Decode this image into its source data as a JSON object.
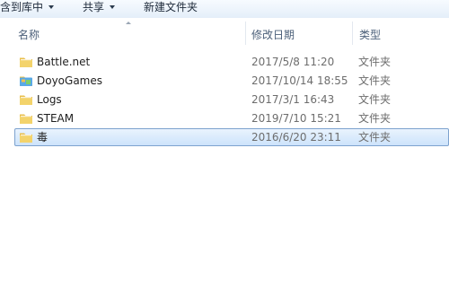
{
  "toolbar": {
    "include_in_library": "含到库中",
    "share": "共享",
    "new_folder": "新建文件夹"
  },
  "columns": {
    "name": "名称",
    "date_modified": "修改日期",
    "type": "类型"
  },
  "files": [
    {
      "name": "Battle.net",
      "date": "2017/5/8 11:20",
      "type": "文件夹",
      "icon": "folder-icon",
      "selected": false
    },
    {
      "name": "DoyoGames",
      "date": "2017/10/14 18:55",
      "type": "文件夹",
      "icon": "doyogames-folder-icon",
      "selected": false
    },
    {
      "name": "Logs",
      "date": "2017/3/1 16:43",
      "type": "文件夹",
      "icon": "folder-icon",
      "selected": false
    },
    {
      "name": "STEAM",
      "date": "2019/7/10 15:21",
      "type": "文件夹",
      "icon": "folder-icon",
      "selected": false
    },
    {
      "name": "毒",
      "date": "2016/6/20 23:11",
      "type": "文件夹",
      "icon": "folder-icon",
      "selected": true
    }
  ],
  "colors": {
    "selection_fill": "#cde3fb",
    "selection_border": "#7da2ce",
    "folder_yellow": "#f3d36b",
    "header_text": "#4c607a",
    "meta_text": "#6d6d6d"
  }
}
